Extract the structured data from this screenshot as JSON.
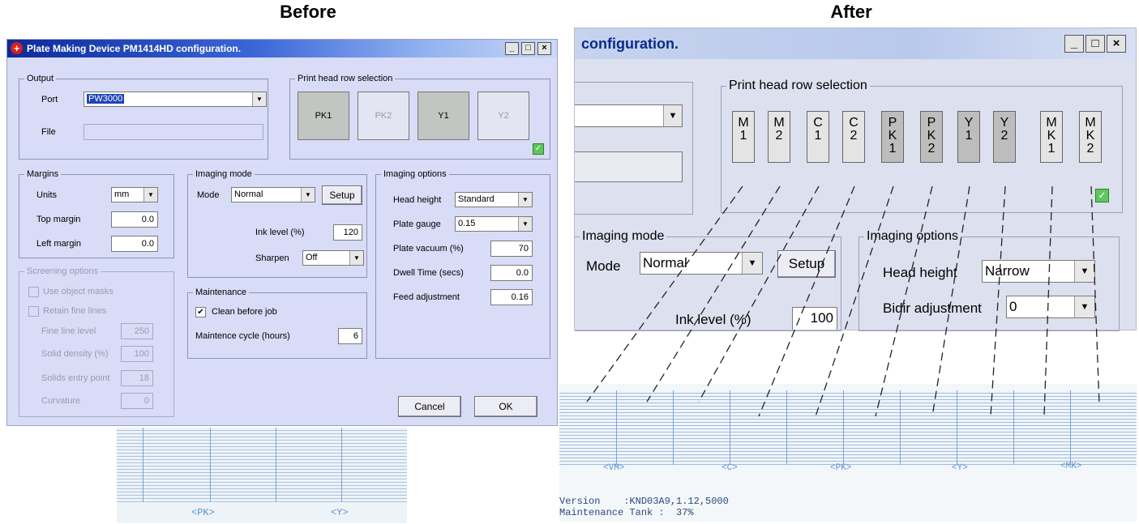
{
  "headings": {
    "before": "Before",
    "after": "After"
  },
  "before": {
    "window": {
      "title": "Plate Making Device PM1414HD configuration.",
      "app_icon": "plus-cross-icon",
      "buttons": [
        "_",
        "□",
        "×"
      ]
    },
    "output": {
      "legend": "Output",
      "port_label": "Port",
      "port_value": "PW3000",
      "file_label": "File",
      "file_value": ""
    },
    "print_head": {
      "legend": "Print head row selection",
      "heads": [
        {
          "label": "PK1",
          "active": true
        },
        {
          "label": "PK2",
          "active": false
        },
        {
          "label": "Y1",
          "active": true
        },
        {
          "label": "Y2",
          "active": false
        }
      ],
      "checked": true
    },
    "margins": {
      "legend": "Margins",
      "units_label": "Units",
      "units_value": "mm",
      "top_label": "Top margin",
      "top_value": "0.0",
      "left_label": "Left margin",
      "left_value": "0.0"
    },
    "screening": {
      "legend": "Screening options",
      "use_masks": "Use object masks",
      "retain_lines": "Retain fine lines",
      "fine_line_label": "Fine line level",
      "fine_line_value": "250",
      "solid_density_label": "Solid density (%)",
      "solid_density_value": "100",
      "solids_entry_label": "Solids entry point",
      "solids_entry_value": "18",
      "curvature_label": "Curvature",
      "curvature_value": "0"
    },
    "imaging_mode": {
      "legend": "Imaging mode",
      "mode_label": "Mode",
      "mode_value": "Normal",
      "setup": "Setup",
      "ink_label": "Ink level (%)",
      "ink_value": "120",
      "sharpen_label": "Sharpen",
      "sharpen_value": "Off"
    },
    "maintenance": {
      "legend": "Maintenance",
      "clean_label": "Clean before job",
      "clean_checked": true,
      "cycle_label": "Maintence cycle (hours)",
      "cycle_value": "6"
    },
    "imaging_options": {
      "legend": "Imaging options",
      "head_height_label": "Head height",
      "head_height_value": "Standard",
      "plate_gauge_label": "Plate gauge",
      "plate_gauge_value": "0.15",
      "vacuum_label": "Plate vacuum (%)",
      "vacuum_value": "70",
      "dwell_label": "Dwell Time (secs)",
      "dwell_value": "0.0",
      "feed_label": "Feed adjustment",
      "feed_value": "0.16"
    },
    "actions": {
      "cancel": "Cancel",
      "ok": "OK"
    },
    "print_sample": {
      "labels": [
        "<PK>",
        "<Y>"
      ]
    }
  },
  "after": {
    "window": {
      "title": "configuration.",
      "buttons": [
        "_",
        "□",
        "×"
      ]
    },
    "print_head": {
      "legend": "Print head row selection",
      "heads": [
        {
          "label": "M\n1",
          "active": false
        },
        {
          "label": "M\n2",
          "active": false
        },
        {
          "label": "C\n1",
          "active": false
        },
        {
          "label": "C\n2",
          "active": false
        },
        {
          "label": "P\nK\n1",
          "active": true
        },
        {
          "label": "P\nK\n2",
          "active": true
        },
        {
          "label": "Y\n1",
          "active": true
        },
        {
          "label": "Y\n2",
          "active": true
        },
        {
          "label": "M\nK\n1",
          "active": false
        },
        {
          "label": "M\nK\n2",
          "active": false
        }
      ],
      "checked": true
    },
    "imaging_mode": {
      "legend": "Imaging mode",
      "mode_label": "Mode",
      "mode_value": "Normal",
      "setup": "Setup",
      "ink_label": "Ink level (%)",
      "ink_value": "100"
    },
    "imaging_options": {
      "legend": "Imaging options",
      "head_height_label": "Head height",
      "head_height_value": "Narrow",
      "bidir_label": "Bidir adjustment",
      "bidir_value": "0"
    },
    "print_sample": {
      "labels": [
        "<VM>",
        "<C>",
        "<PK>",
        "<Y>",
        "<MK>"
      ],
      "version": "Version    :KND03A9,1.12,5000",
      "maintenance_tank": "Maintenance Tank :  37%"
    }
  }
}
